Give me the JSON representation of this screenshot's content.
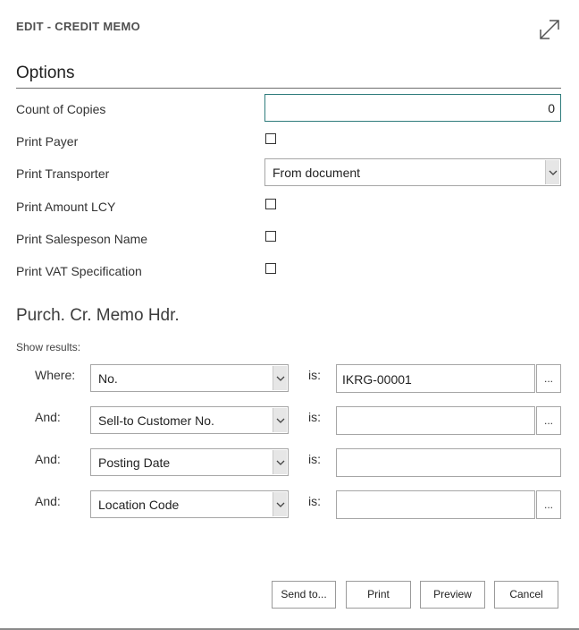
{
  "dialog": {
    "caption": "EDIT - CREDIT MEMO",
    "expand_icon": "expand-arrows-icon"
  },
  "options": {
    "title": "Options",
    "count_of_copies": {
      "label": "Count of Copies",
      "value": "0"
    },
    "print_payer": {
      "label": "Print Payer",
      "checked": false
    },
    "print_transporter": {
      "label": "Print Transporter",
      "value": "From document"
    },
    "print_amount_lcy": {
      "label": "Print Amount LCY",
      "checked": false
    },
    "print_salesperson_name": {
      "label": "Print Salespeson Name",
      "checked": false
    },
    "print_vat_specification": {
      "label": "Print VAT Specification",
      "checked": false
    }
  },
  "filters": {
    "title": "Purch. Cr. Memo Hdr.",
    "show_results": "Show results:",
    "is_label": "is:",
    "rows": [
      {
        "prefix": "Where:",
        "field": "No.",
        "value": "IKRG-00001",
        "has_assist": true
      },
      {
        "prefix": "And:",
        "field": "Sell-to Customer No.",
        "value": "",
        "has_assist": true
      },
      {
        "prefix": "And:",
        "field": "Posting Date",
        "value": "",
        "has_assist": false
      },
      {
        "prefix": "And:",
        "field": "Location Code",
        "value": "",
        "has_assist": true
      }
    ],
    "assist_label": "..."
  },
  "actions": {
    "send_to": "Send to...",
    "print": "Print",
    "preview": "Preview",
    "cancel": "Cancel"
  }
}
